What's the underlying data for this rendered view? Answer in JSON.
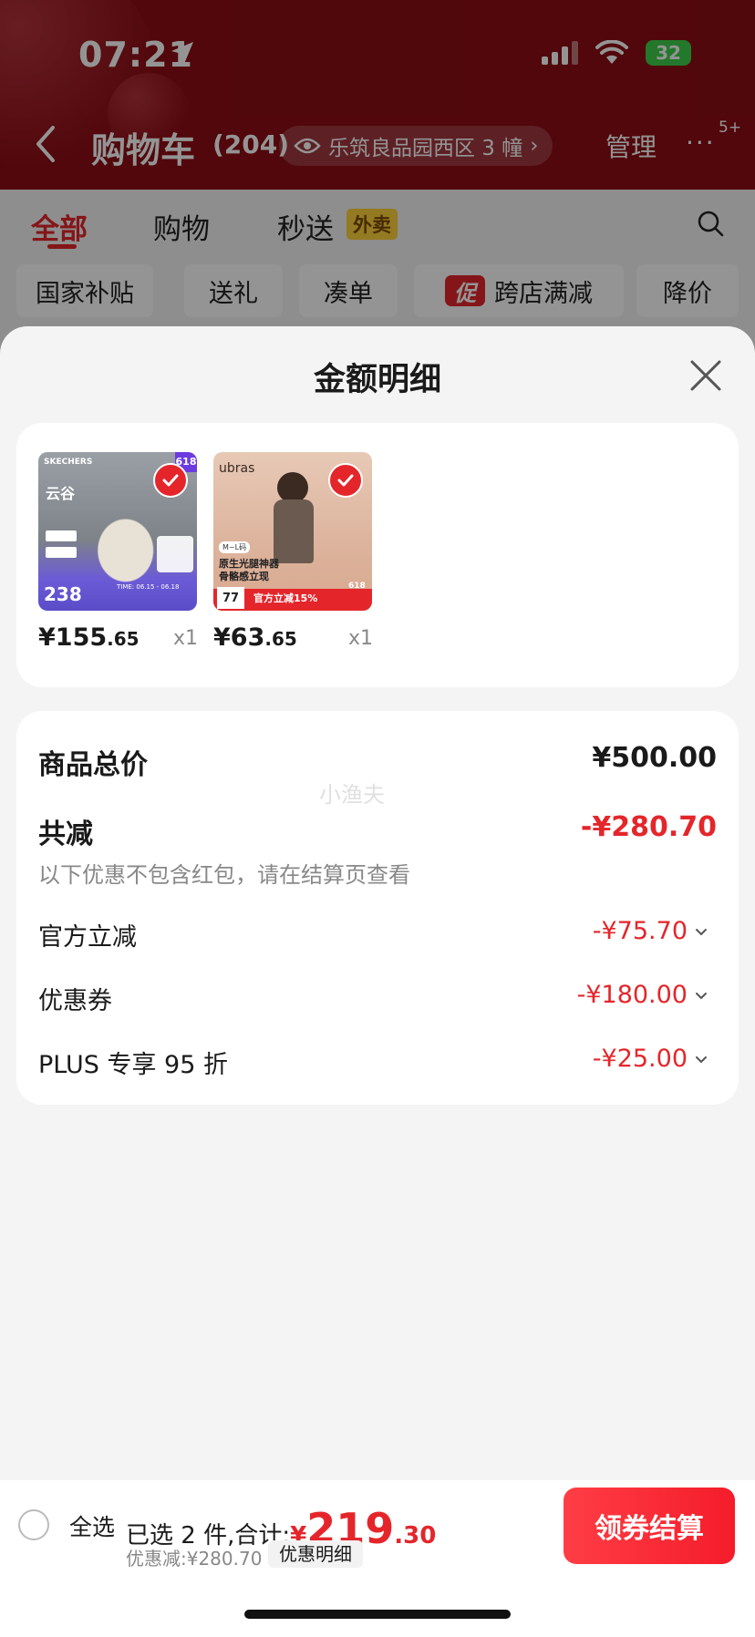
{
  "status": {
    "time": "07:21",
    "battery": "32"
  },
  "header": {
    "title": "购物车",
    "count": "(204)",
    "location": "乐筑良品园西区 3 幢",
    "manage": "管理",
    "more_badge": "5+"
  },
  "tabs": [
    {
      "label": "全部"
    },
    {
      "label": "购物"
    },
    {
      "label": "秒送"
    }
  ],
  "waimai_badge": "外卖",
  "chips": [
    {
      "label": "国家补贴"
    },
    {
      "label": "送礼"
    },
    {
      "label": "凑单"
    },
    {
      "label": "跨店满减",
      "badge": "促"
    },
    {
      "label": "降价"
    }
  ],
  "sheet": {
    "title": "金额明细",
    "products": [
      {
        "price_main": "¥155",
        "price_dec": ".65",
        "qty": "x1",
        "img_text": {
          "brand": "SKECHERS",
          "tag_618": "618",
          "name": "云谷",
          "price": "238",
          "time": "TIME: 06.15 - 06.18"
        }
      },
      {
        "price_main": "¥63",
        "price_dec": ".65",
        "qty": "x1",
        "img_text": {
          "brand": "ubras",
          "size": "M~L码",
          "line1": "原生光腿神器",
          "line2": "骨骼感立现",
          "price": "77",
          "banner": "官方立减15%",
          "tag_618": "618"
        }
      }
    ],
    "total_label": "商品总价",
    "total_value": "¥500.00",
    "reduce_label": "共减",
    "reduce_value": "-¥280.70",
    "reduce_note": "以下优惠不包含红包，请在结算页查看",
    "watermark": "小渔夫",
    "discounts": [
      {
        "label": "官方立减",
        "value": "-¥75.70"
      },
      {
        "label": "优惠券",
        "value": "-¥180.00"
      },
      {
        "label": "PLUS 专享 95 折",
        "value": "-¥25.00"
      }
    ]
  },
  "bottom": {
    "select_all": "全选",
    "selected": "已选 2 件,合计:",
    "currency": "¥",
    "total_int": "219",
    "total_dec": ".30",
    "discount_text": "优惠减:¥280.70",
    "detail_btn": "优惠明细",
    "checkout": "领券结算"
  },
  "colors": {
    "brand_red": "#e4262b",
    "header_bg": "#8c0d14",
    "waimai_yellow": "#ffd23c"
  }
}
